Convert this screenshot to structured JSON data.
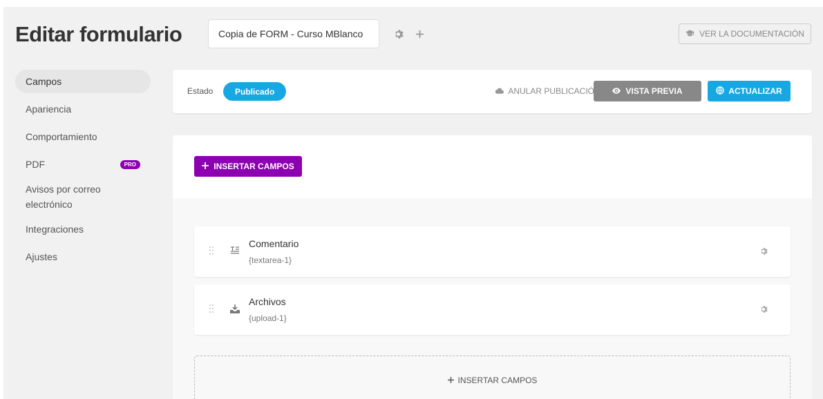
{
  "header": {
    "title": "Editar formulario",
    "form_name": "Copia de FORM - Curso MBlanco",
    "settings_icon": "gear-icon",
    "add_icon": "plus-icon",
    "doc_button": "VER LA DOCUMENTACIÓN",
    "doc_icon": "graduation-cap-icon"
  },
  "sidebar": {
    "items": [
      {
        "label": "Campos",
        "active": true
      },
      {
        "label": "Apariencia"
      },
      {
        "label": "Comportamiento"
      },
      {
        "label": "PDF",
        "badge": "PRO"
      },
      {
        "label": "Avisos por correo electrónico"
      },
      {
        "label": "Integraciones"
      },
      {
        "label": "Ajustes"
      }
    ]
  },
  "status_bar": {
    "label": "Estado",
    "status": "Publicado",
    "unpublish": "ANULAR PUBLICACIÓN",
    "preview": "VISTA PREVIA",
    "update": "ACTUALIZAR"
  },
  "insert_button": "INSERTAR CAMPOS",
  "fields": [
    {
      "title": "Comentario",
      "key": "{textarea-1}",
      "icon": "textarea-icon"
    },
    {
      "title": "Archivos",
      "key": "{upload-1}",
      "icon": "upload-icon"
    }
  ],
  "insert_bottom": "INSERTAR CAMPOS",
  "colors": {
    "accent_blue": "#17a8e3",
    "accent_purple": "#8d00b1",
    "preview_gray": "#888888",
    "background": "#f1f1f1"
  }
}
